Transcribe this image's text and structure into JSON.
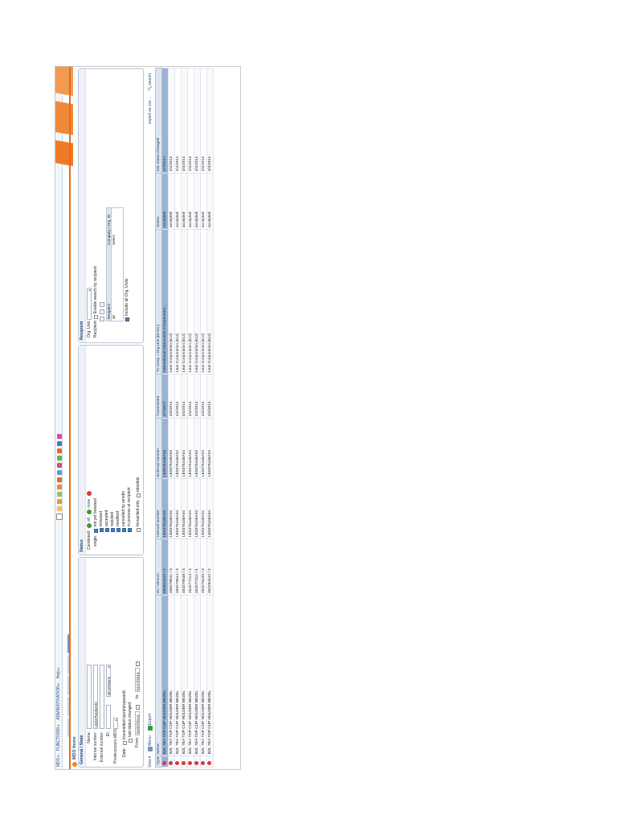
{
  "app": {
    "menu": [
      {
        "label": "MDS",
        "caret": "▾"
      },
      {
        "label": "FUNCTIONS",
        "caret": "▾"
      },
      {
        "label": "ADMINISTRATION",
        "caret": "▾"
      },
      {
        "label": "Help",
        "caret": "▾"
      }
    ],
    "tabs": [
      "",
      "",
      "",
      "",
      ""
    ],
    "title": "MDS Items"
  },
  "general": {
    "heading": "General / State",
    "name_label": "Name:",
    "name_value": "",
    "internal_label": "Internal number:",
    "internal_value": "LE0375446A04",
    "external_label": "External number:",
    "external_value": "",
    "id_label": "ID:",
    "version_label": "",
    "version_value": "all versions",
    "predecessor_label": "Predecessors MDS:",
    "date_option1": "transmitted (sent/proposed)",
    "date_option2": "last status changed",
    "date_label": "Date:",
    "from_label": "From:",
    "from_value": "01/07/2014",
    "to_label": "to:",
    "to_value": "01/17/2014"
  },
  "status": {
    "heading": "Status",
    "combined_label": "Combined:",
    "all_label": "all",
    "none_label": "none",
    "single_label": "single:",
    "options": [
      {
        "label": "not yet browsed",
        "checked": true
      },
      {
        "label": "browsed",
        "checked": true
      },
      {
        "label": "accepted",
        "checked": true
      },
      {
        "label": "rejected",
        "checked": true
      },
      {
        "label": "modified",
        "checked": true
      },
      {
        "label": "cancelled by sender",
        "checked": true
      },
      {
        "label": "in process at recipient",
        "checked": true
      }
    ],
    "forwarded_label": "forwarded only",
    "obsolete_label": "obsolete"
  },
  "recipient": {
    "heading": "Recipient",
    "org_unit_label": "Org. Unit",
    "recipient_label": "Recipient",
    "enable_label": "Enable search by recipient",
    "list_header": "Recipient",
    "list_header_right": "Company / Org. ID",
    "list_row": "all",
    "list_row_right": "Select",
    "include_label": "Include all Org. Units"
  },
  "grid_toolbar": {
    "view_label": "View",
    "menu_label": "Menu",
    "export_label": "Export",
    "export_xls_label": "export as csv ...",
    "search_label": "search"
  },
  "columns": [
    "Type",
    "Name",
    "ID / Version",
    "Internal number",
    "External number",
    "Transmitted",
    "To comp. / Org.Unit [ID No.]",
    "Status",
    "last status changed"
  ],
  "rows": [
    [
      "",
      "BZL TEA TOP CUP HOLDER BEZEL",
      "632821610 / 2",
      "LE0375446A04",
      "LE0375446A04",
      "4/7/2017",
      "International Automotive Components...",
      "accepted",
      "4/7/2017"
    ],
    [
      "",
      "BZL TEA TOP CUP HOLDER BEZEL",
      "466278541 / 3",
      "LE0375446A04",
      "LE0375446A04",
      "4/4/2014",
      "Lear Corporation [612]",
      "accepted",
      "4/4/2014"
    ],
    [
      "",
      "BZL TEA TOP CUP HOLDER BEZEL",
      "469278544 / 3",
      "LE0375446A04",
      "LE0375446A04",
      "4/4/2014",
      "Lear Corporation [612]",
      "accepted",
      "4/4/2014"
    ],
    [
      "",
      "BZL TEA TOP CUP HOLDER BEZEL",
      "463278548 / 3",
      "LE0375446A04",
      "LE0375446A04",
      "4/4/2014",
      "Lear Corporation [612]",
      "accepted",
      "4/4/2014"
    ],
    [
      "",
      "BZL TEA TOP CUP HOLDER BEZEL",
      "463277213 / 3",
      "LE0375446A04",
      "LE0375446A04",
      "4/4/2014",
      "Lear Corporation [612]",
      "accepted",
      "4/4/2014"
    ],
    [
      "",
      "BZL TEA TOP CUP HOLDER BEZEL",
      "463277311 / 3",
      "LE0375446A04",
      "LE0375446A04",
      "4/4/2014",
      "Lear Corporation [612]",
      "accepted",
      "4/4/2014"
    ],
    [
      "",
      "BZL TEA TOP CUP HOLDER BEZEL",
      "463275439 / 3",
      "LE0375446A04",
      "LE0375446A04",
      "4/4/2014",
      "Lear Corporation [612]",
      "accepted",
      "4/4/2014"
    ],
    [
      "",
      "BZL TEA TOP CUP HOLDER BEZEL",
      "462294442 / 2",
      "LE0375446A04",
      "LE0375446A04",
      "4/4/2014",
      "Lear Corporation [612]",
      "accepted",
      "4/4/2014"
    ]
  ],
  "colors": {
    "accent": "#e86a1a",
    "header": "#dde5f0",
    "selected_row": "#9cb2d3",
    "link": "#1d4d8a"
  }
}
